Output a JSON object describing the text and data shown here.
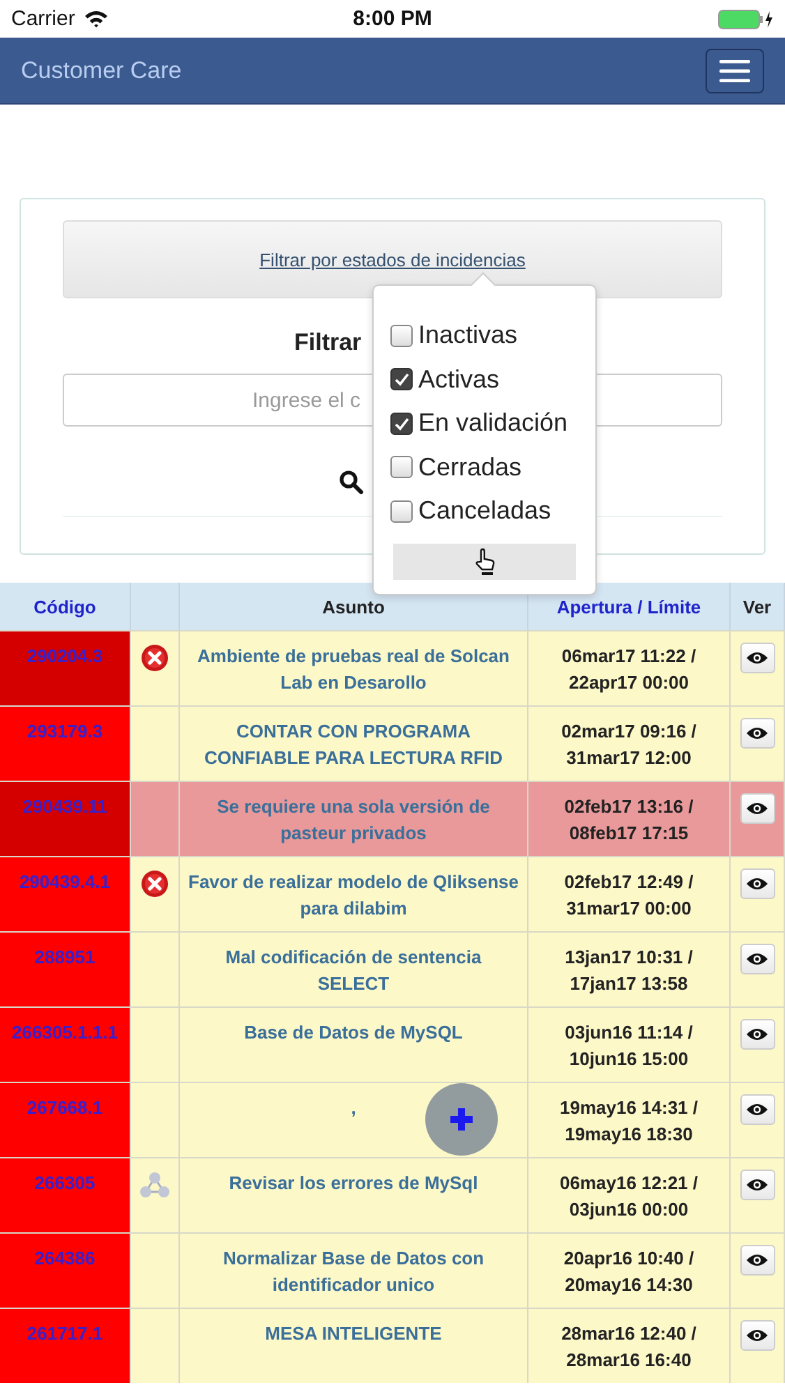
{
  "status_bar": {
    "carrier": "Carrier",
    "time": "8:00 PM"
  },
  "navbar": {
    "title": "Customer Care"
  },
  "filter": {
    "link": "Filtrar por estados de incidencias",
    "label": "Filtrar",
    "placeholder": "Ingrese el c"
  },
  "popover": {
    "options": [
      {
        "label": "Inactivas",
        "checked": false
      },
      {
        "label": "Activas",
        "checked": true
      },
      {
        "label": "En validación",
        "checked": true
      },
      {
        "label": "Cerradas",
        "checked": false
      },
      {
        "label": "Canceladas",
        "checked": false
      }
    ]
  },
  "table": {
    "columns": [
      {
        "label": "Código",
        "sortable": true
      },
      {
        "label": "Asunto",
        "sortable": false
      },
      {
        "label": "Apertura / Límite",
        "sortable": true
      },
      {
        "label": "Ver",
        "sortable": false
      }
    ],
    "rows": [
      {
        "code": "290204.3",
        "color": "#d40000",
        "kind": "error",
        "subject": "Ambiente de pruebas real de Solcan Lab en Desarollo",
        "dates": "06mar17 11:22 / 22apr17 00:00",
        "highlighted": false
      },
      {
        "code": "293179.3",
        "color": "#ff0000",
        "kind": "plain",
        "subject": "CONTAR CON PROGRAMA CONFIABLE PARA LECTURA RFID",
        "dates": "02mar17 09:16 / 31mar17 12:00",
        "highlighted": false
      },
      {
        "code": "290439.11",
        "color": "#d40000",
        "kind": "plain",
        "subject": "Se requiere una sola versión de pasteur privados",
        "dates": "02feb17 13:16 / 08feb17 17:15",
        "highlighted": true
      },
      {
        "code": "290439.4.1",
        "color": "#ff0000",
        "kind": "error",
        "subject": "Favor de realizar modelo de Qliksense para dilabim",
        "dates": "02feb17 12:49 / 31mar17 00:00",
        "highlighted": false
      },
      {
        "code": "288951",
        "color": "#ff0000",
        "kind": "plain",
        "subject": "Mal codificación de sentencia SELECT",
        "dates": "13jan17 10:31 / 17jan17 13:58",
        "highlighted": false
      },
      {
        "code": "266305.1.1.1",
        "color": "#ff0000",
        "kind": "plain",
        "subject": "Base de Datos de MySQL",
        "dates": "03jun16 11:14 / 10jun16 15:00",
        "highlighted": false
      },
      {
        "code": "267668.1",
        "color": "#ff0000",
        "kind": "plain",
        "subject": ",",
        "dates": "19may16 14:31 / 19may16 18:30",
        "highlighted": false
      },
      {
        "code": "266305",
        "color": "#ff0000",
        "kind": "linked",
        "subject": "Revisar los errores de MySql",
        "dates": "06may16 12:21 / 03jun16 00:00",
        "highlighted": false
      },
      {
        "code": "264386",
        "color": "#ff0000",
        "kind": "plain",
        "subject": "Normalizar Base de Datos con identificador unico",
        "dates": "20apr16 10:40 / 20may16 14:30",
        "highlighted": false
      },
      {
        "code": "261717.1",
        "color": "#ff0000",
        "kind": "plain",
        "subject": "MESA INTELIGENTE",
        "dates": "28mar16 12:40 / 28mar16 16:40",
        "highlighted": false
      }
    ]
  }
}
